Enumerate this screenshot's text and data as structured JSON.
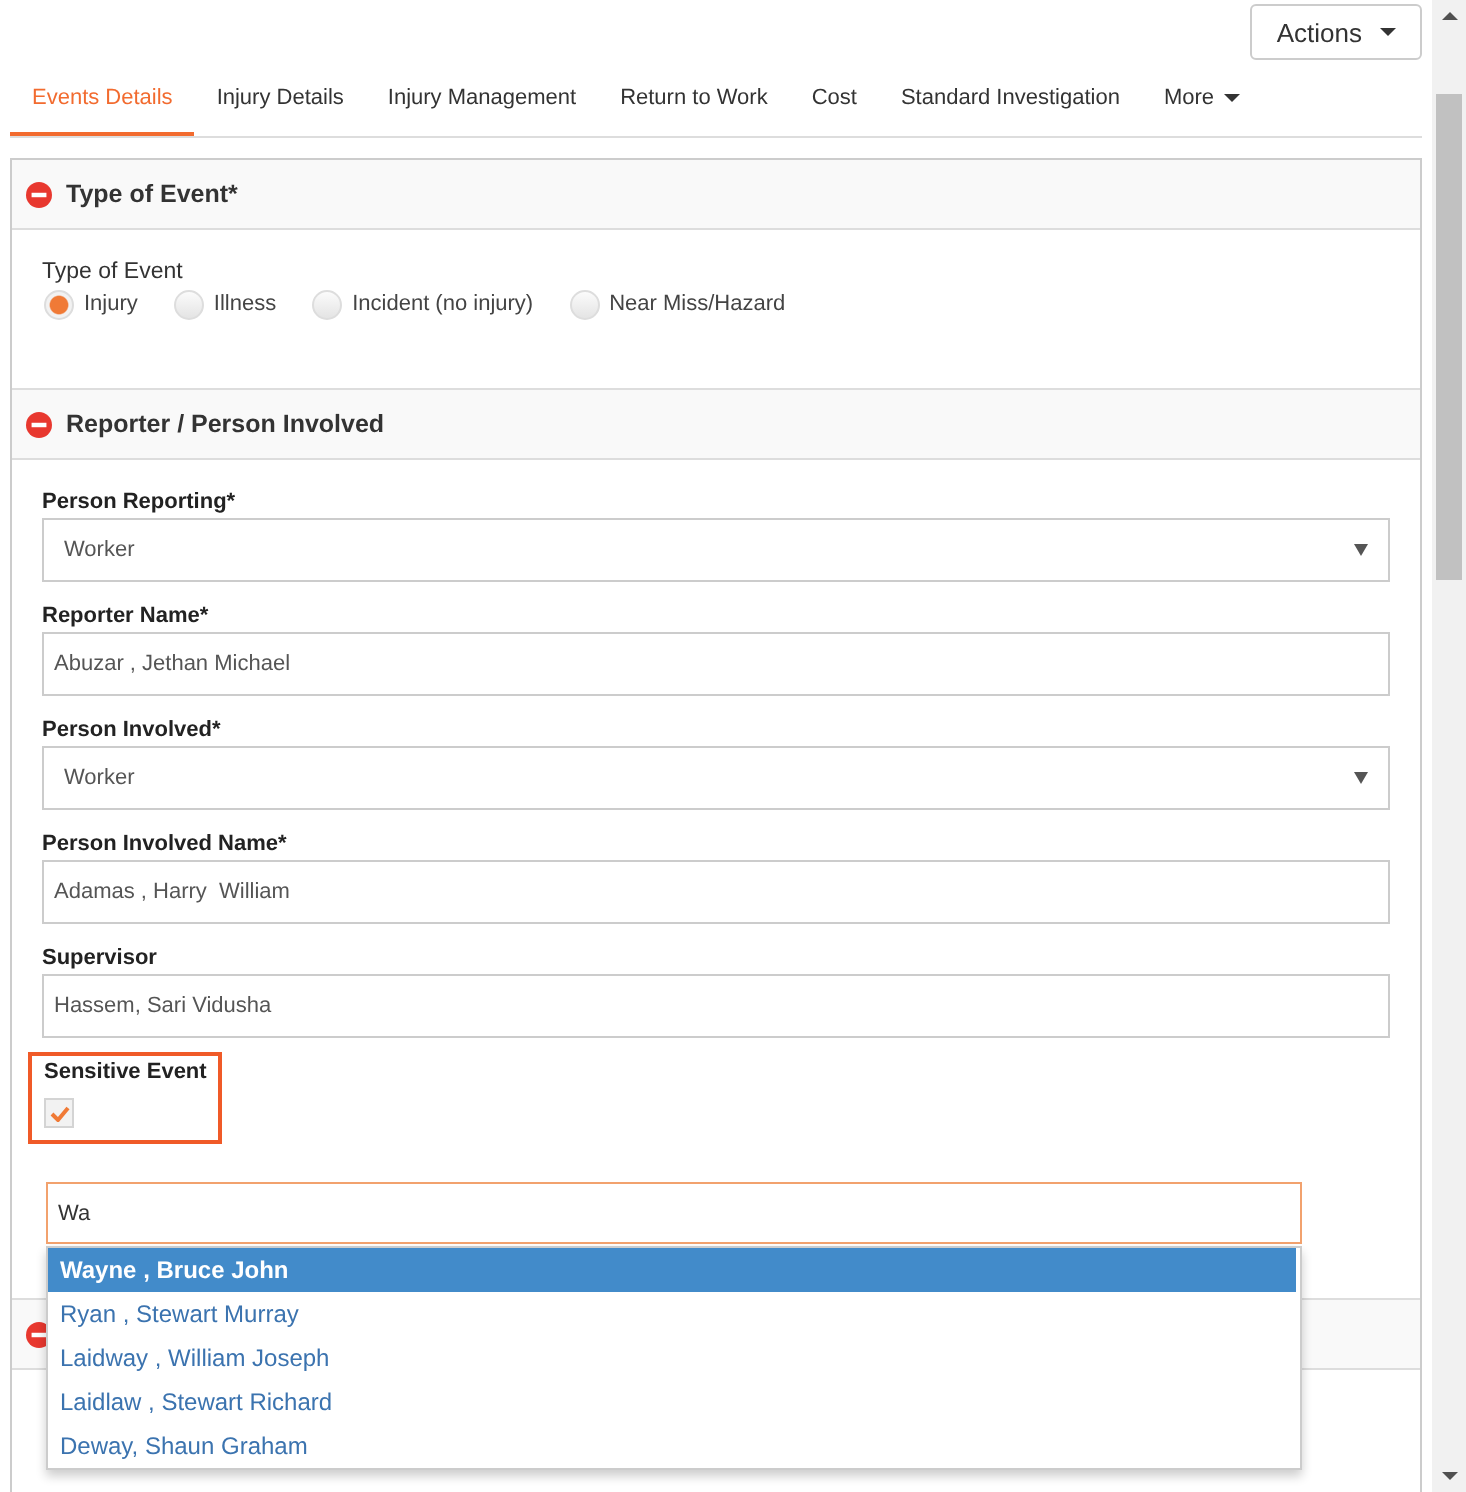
{
  "toolbar": {
    "actions_button": "Actions"
  },
  "tabs": [
    {
      "label": "Events Details",
      "selected": true,
      "kind": "tab"
    },
    {
      "label": "Injury Details",
      "selected": false,
      "kind": "tab"
    },
    {
      "label": "Injury Management",
      "selected": false,
      "kind": "tab"
    },
    {
      "label": "Return to Work",
      "selected": false,
      "kind": "tab"
    },
    {
      "label": "Cost",
      "selected": false,
      "kind": "tab"
    },
    {
      "label": "Standard Investigation",
      "selected": false,
      "kind": "tab"
    },
    {
      "label": "More",
      "selected": false,
      "kind": "menu"
    }
  ],
  "sections": [
    {
      "title": "Type of Event*",
      "expanded": true,
      "fields": [
        {
          "kind": "radio_group",
          "label": "Type of Event",
          "options": [
            {
              "label": "Injury",
              "selected": true
            },
            {
              "label": "Illness",
              "selected": false
            },
            {
              "label": "Incident (no injury)",
              "selected": false
            },
            {
              "label": "Near Miss/Hazard",
              "selected": false
            }
          ]
        }
      ]
    },
    {
      "title": "Reporter / Person Involved",
      "expanded": true,
      "fields": [
        {
          "kind": "select",
          "label": "Person Reporting*",
          "value": "Worker"
        },
        {
          "kind": "text",
          "label": "Reporter Name*",
          "value": "Abuzar , Jethan Michael"
        },
        {
          "kind": "select",
          "label": "Person Involved*",
          "value": "Worker"
        },
        {
          "kind": "text",
          "label": "Person Involved Name*",
          "value": "Adamas , Harry  William"
        },
        {
          "kind": "text",
          "label": "Supervisor",
          "value": "Hassem, Sari Vidusha"
        },
        {
          "kind": "checkbox",
          "label": "Sensitive Event",
          "checked": true,
          "highlighted": true
        },
        {
          "kind": "autocomplete",
          "value": "Wa",
          "focused": true,
          "suggestions": [
            {
              "label": "Wayne , Bruce John",
              "selected": true
            },
            {
              "label": "Ryan , Stewart Murray",
              "selected": false
            },
            {
              "label": "Laidway , William Joseph",
              "selected": false
            },
            {
              "label": "Laidlaw , Stewart Richard",
              "selected": false
            },
            {
              "label": "Deway, Shaun Graham",
              "selected": false
            }
          ]
        }
      ]
    },
    {
      "expanded": true
    }
  ]
}
